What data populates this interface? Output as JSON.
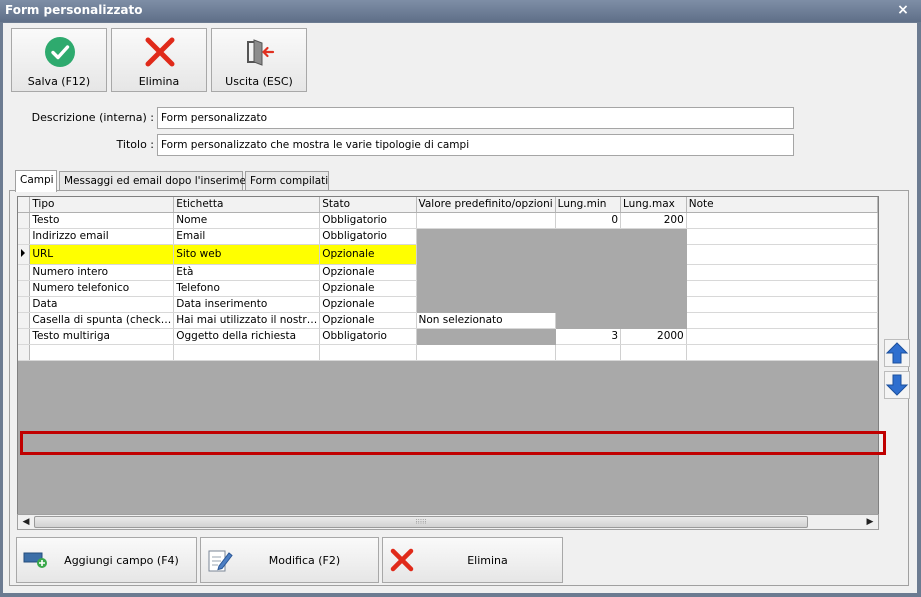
{
  "window": {
    "title": "Form personalizzato",
    "close_glyph": "×"
  },
  "toolbar": {
    "save_label": "Salva (F12)",
    "delete_label": "Elimina",
    "exit_label": "Uscita (ESC)"
  },
  "form": {
    "description_label": "Descrizione (interna) :",
    "description_value": "Form personalizzato",
    "title_label": "Titolo :",
    "title_value": "Form personalizzato che mostra le varie tipologie di campi"
  },
  "tabs": [
    {
      "label": "Campi"
    },
    {
      "label": "Messaggi ed email dopo l'inserimento"
    },
    {
      "label": "Form compilati"
    }
  ],
  "grid": {
    "headers": [
      "Tipo",
      "Etichetta",
      "Stato",
      "Valore predefinito/opzioni",
      "Lung.min",
      "Lung.max",
      "Note"
    ],
    "rows": [
      {
        "tipo": "Testo",
        "etichetta": "Nome",
        "stato": "Obbligatorio",
        "valore": "",
        "min": "0",
        "max": "200",
        "note": ""
      },
      {
        "tipo": "Indirizzo email",
        "etichetta": "Email",
        "stato": "Obbligatorio",
        "valore": "",
        "min": "",
        "max": "",
        "note": ""
      },
      {
        "tipo": "URL",
        "etichetta": "Sito web",
        "stato": "Opzionale",
        "valore": "",
        "min": "",
        "max": "",
        "note": ""
      },
      {
        "tipo": "Numero intero",
        "etichetta": "Età",
        "stato": "Opzionale",
        "valore": "",
        "min": "",
        "max": "",
        "note": ""
      },
      {
        "tipo": "Numero telefonico",
        "etichetta": "Telefono",
        "stato": "Opzionale",
        "valore": "",
        "min": "",
        "max": "",
        "note": ""
      },
      {
        "tipo": "Data",
        "etichetta": "Data inserimento",
        "stato": "Opzionale",
        "valore": "",
        "min": "",
        "max": "",
        "note": ""
      },
      {
        "tipo": "Casella di spunta (check…",
        "etichetta": "Hai mai utilizzato il nostr…",
        "stato": "Opzionale",
        "valore": "Non selezionato",
        "min": "",
        "max": "",
        "note": ""
      },
      {
        "tipo": "Testo multiriga",
        "etichetta": "Oggetto della richiesta",
        "stato": "Obbligatorio",
        "valore": "",
        "min": "3",
        "max": "2000",
        "note": ""
      }
    ]
  },
  "bottom": {
    "add_label": "Aggiungi campo (F4)",
    "edit_label": "Modifica (F2)",
    "delete_label": "Elimina"
  },
  "colors": {
    "selected_row": "#ffff00",
    "highlight_border": "#c00000",
    "disabled_cell": "#a9a9a9"
  }
}
